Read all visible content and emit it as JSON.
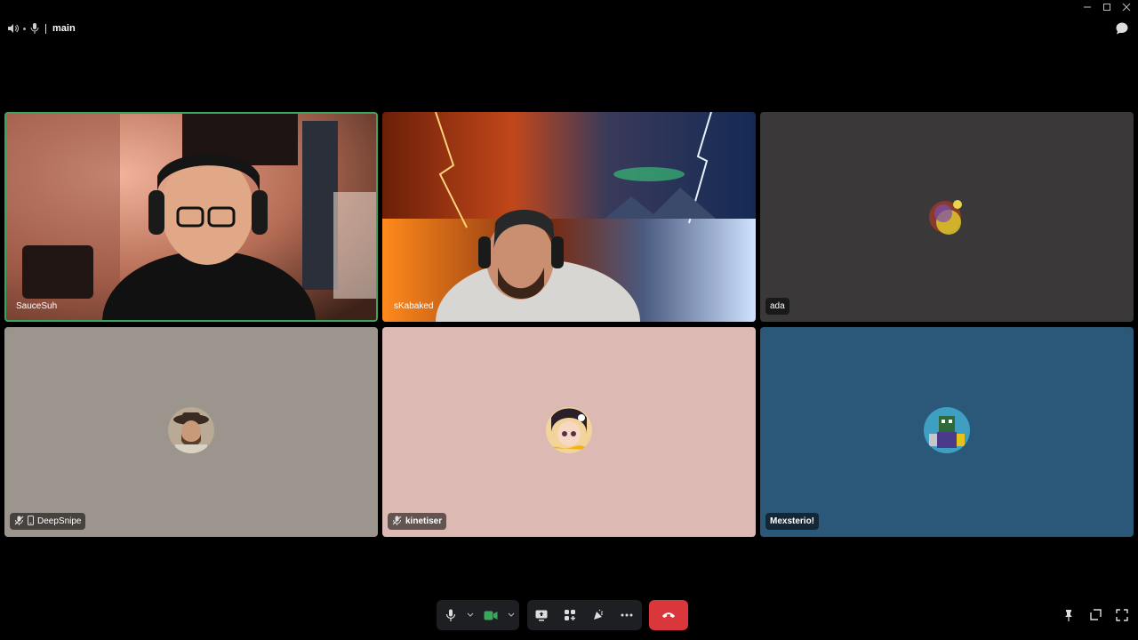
{
  "header": {
    "channel_name": "main"
  },
  "participants": [
    {
      "name": "SauceSuh",
      "muted": false,
      "video": true,
      "speaking": true
    },
    {
      "name": "sKabaked",
      "muted": false,
      "video": true,
      "speaking": false
    },
    {
      "name": "ada",
      "muted": false,
      "video": false,
      "bg": "#3a3838"
    },
    {
      "name": "DeepSnipe",
      "muted": true,
      "mobile": true,
      "video": false,
      "bg": "#9b958d"
    },
    {
      "name": "kinetiser",
      "muted": true,
      "video": false,
      "bg": "#dcbab3"
    },
    {
      "name": "Mexsterio!",
      "muted": false,
      "video": false,
      "bg": "#2b5878"
    }
  ],
  "colors": {
    "accent_green": "#3ba55d",
    "hangup_red": "#da373c",
    "control_bg": "#1e1f22"
  },
  "controls": {
    "icons": [
      "microphone-icon",
      "video-camera-icon",
      "screen-share-icon",
      "activities-icon",
      "soundboard-icon",
      "more-icon",
      "hang-up-icon"
    ],
    "right_icons": [
      "pin-icon",
      "pop-out-icon",
      "fullscreen-icon"
    ]
  }
}
